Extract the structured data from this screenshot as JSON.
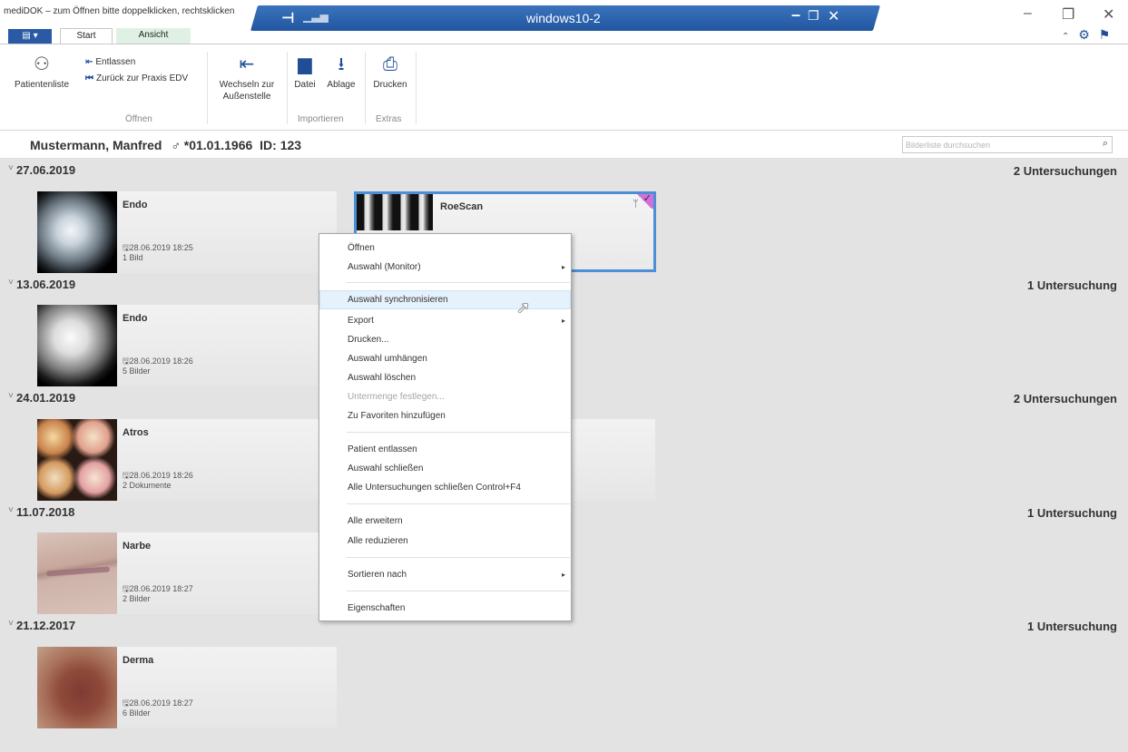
{
  "window": {
    "app_title": "mediDOK – zum Öffnen bitte doppelklicken, rechtsklicken",
    "rdp_title": "windows10-2",
    "rdp_pin": "⊣",
    "rdp_minimize": "–",
    "rdp_restore": "❐",
    "rdp_close": "✕",
    "minimize": "–",
    "maximize": "❐",
    "close": "✕"
  },
  "ribbon_tabs": {
    "app_menu": "▤ ▾",
    "start": "Start",
    "ansicht": "Ansicht"
  },
  "ribbon": {
    "patientenliste": "Patientenliste",
    "entlassen": "Entlassen",
    "zurueck": "Zurück zur Praxis EDV",
    "group_oeffnen": "Öffnen",
    "wechseln_line1": "Wechseln zur",
    "wechseln_line2": "Außenstelle",
    "datei": "Datei",
    "ablage": "Ablage",
    "group_importieren": "Importieren",
    "drucken": "Drucken",
    "group_extras": "Extras"
  },
  "patient": {
    "name": "Mustermann, Manfred",
    "sex_symbol": "♂",
    "birth": "*01.01.1966",
    "id": "ID: 123"
  },
  "search": {
    "placeholder": "Bilderliste durchsuchen"
  },
  "groups": [
    {
      "date": "27.06.2019",
      "count": "2 Untersuchungen",
      "cards": [
        {
          "title": "Endo",
          "date": "28.06.2019 18:25",
          "count": "1 Bild"
        },
        {
          "title": "RoeScan"
        }
      ]
    },
    {
      "date": "13.06.2019",
      "count": "1 Untersuchung",
      "cards": [
        {
          "title": "Endo",
          "date": "28.06.2019 18:26",
          "count": "5 Bilder"
        }
      ]
    },
    {
      "date": "24.01.2019",
      "count": "2 Untersuchungen",
      "cards": [
        {
          "title": "Atros",
          "date": "28.06.2019 18:26",
          "count": "2 Dokumente"
        }
      ]
    },
    {
      "date": "11.07.2018",
      "count": "1 Untersuchung",
      "cards": [
        {
          "title": "Narbe",
          "date": "28.06.2019 18:27",
          "count": "2 Bilder"
        }
      ]
    },
    {
      "date": "21.12.2017",
      "count": "1 Untersuchung",
      "cards": [
        {
          "title": "Derma",
          "date": "28.06.2019 18:27",
          "count": "6 Bilder"
        }
      ]
    }
  ],
  "context_menu": {
    "items": [
      {
        "label": "Öffnen"
      },
      {
        "label": "Auswahl (Monitor)",
        "submenu": true
      },
      {
        "label": "Auswahl synchronisieren",
        "hover": true
      },
      {
        "label": "Export",
        "submenu": true
      },
      {
        "label": "Drucken..."
      },
      {
        "label": "Auswahl umhängen"
      },
      {
        "label": "Auswahl löschen"
      },
      {
        "label": "Untermenge festlegen...",
        "disabled": true
      },
      {
        "label": "Zu Favoriten hinzufügen"
      },
      {
        "label": "Patient entlassen"
      },
      {
        "label": "Auswahl schließen"
      },
      {
        "label": "Alle Untersuchungen schließen   Control+F4"
      },
      {
        "label": "Alle erweitern"
      },
      {
        "label": "Alle reduzieren"
      },
      {
        "label": "Sortieren nach",
        "submenu": true
      },
      {
        "label": "Eigenschaften"
      }
    ],
    "submenu_arrow": "▸"
  },
  "icons": {
    "chevron": "˅",
    "save_icon": "🖫",
    "search": "⌕",
    "check": "✓",
    "antenna": "📡"
  },
  "colors": {
    "accent_blue": "#2b5aa5",
    "selection_border": "#4c8fd6",
    "hover_bg": "#e5f1fb"
  }
}
